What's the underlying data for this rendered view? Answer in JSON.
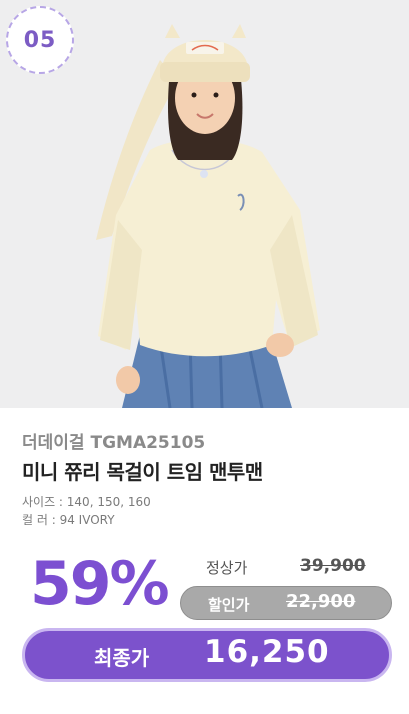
{
  "badge": {
    "number": "05"
  },
  "product": {
    "brand": "더데이걸 TGMA25105",
    "title": "미니 쮸리 목걸이 트임 맨투맨",
    "size_line": "사이즈 : 140, 150, 160",
    "color_line": "컬    러 : 94 IVORY"
  },
  "pricing": {
    "discount": "59%",
    "regular_label": "정상가",
    "regular_price": "39,900",
    "sale_label": "할인가",
    "sale_price": "22,900",
    "final_label": "최종가",
    "final_price": "16,250"
  },
  "colors": {
    "accent": "#7c52cc",
    "discount": "#7c4fd1",
    "sale_pill": "#a9a9a9"
  }
}
